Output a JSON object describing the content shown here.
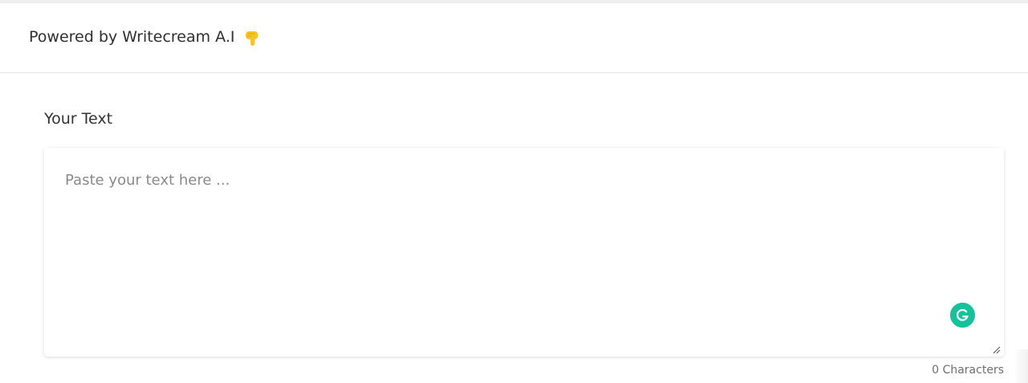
{
  "header": {
    "title": "Powered by Writecream A.I",
    "title_icon": "hand-pointing-down-icon"
  },
  "main": {
    "section_label": "Your Text",
    "textarea": {
      "placeholder": "Paste your text here ...",
      "value": ""
    },
    "grammarly_icon": "grammarly-icon",
    "char_count": "0 Characters"
  },
  "colors": {
    "grammarly": "#15c39a",
    "pointer_emoji": "#f7c325",
    "placeholder": "#8a8a8a"
  }
}
